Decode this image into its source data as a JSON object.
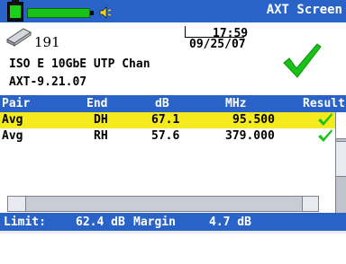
{
  "header": {
    "title": "AXT Screen"
  },
  "status": {
    "count": "191",
    "time": "17:59",
    "date": "09/25/07",
    "cable": "ISO E 10GbE UTP Chan",
    "test_id": "AXT-9.21.07"
  },
  "table": {
    "columns": [
      "Pair",
      "End",
      "dB",
      "MHz",
      "Result"
    ],
    "rows": [
      {
        "pair": "Avg",
        "end": "DH",
        "db": "67.1",
        "mhz": "95.500"
      },
      {
        "pair": "Avg",
        "end": "RH",
        "db": "57.6",
        "mhz": "379.000"
      }
    ]
  },
  "limit": {
    "label": "Limit:",
    "limit_value": "62.4 dB",
    "margin_label": "Margin",
    "margin_value": "4.7 dB"
  },
  "colors": {
    "accent": "#2a63c8",
    "highlight_row": "#f5ea1e",
    "pass_check": "#17c317"
  },
  "icons": [
    "battery-icon",
    "signal-level-icon",
    "speaker-icon",
    "tape-cartridge-icon",
    "pass-check-icon"
  ]
}
